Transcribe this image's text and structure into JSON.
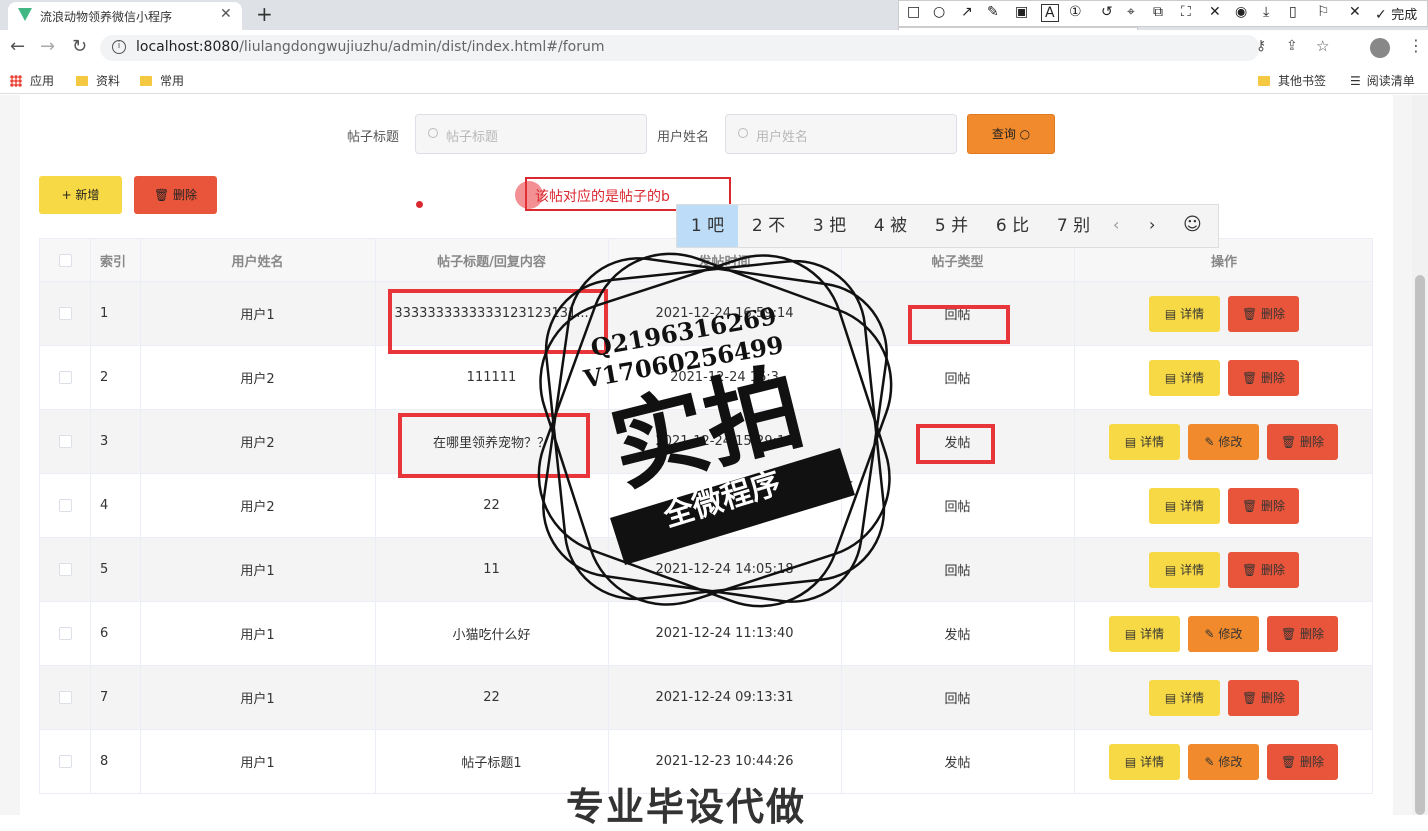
{
  "browser": {
    "tab_title": "流浪动物领养微信小程序",
    "tab_close": "✕",
    "new_tab": "+",
    "url_host": "localhost:8080",
    "url_rest": "/liulangdongwujiuzhu/admin/dist/index.html#/forum",
    "bookmarks": [
      "应用",
      "资料",
      "常用"
    ],
    "bookmarks_right": [
      "其他书签",
      "阅读清单"
    ]
  },
  "snip_tool": {
    "done_label": "完成",
    "font_size": "12",
    "current_color": "#e8353a",
    "palette": [
      "#000000",
      "#7f7f7f",
      "#880015",
      "#ed1c24",
      "#ff7f27",
      "#22b14c",
      "#3f48cc",
      "#a349a4",
      "#00a2e8",
      "#ffffff",
      "#c3c3c3",
      "#ff0000",
      "#ff3300",
      "#fff200",
      "#b5e61d",
      "#3399ff",
      "#cc33ff",
      "#33cccc"
    ]
  },
  "search": {
    "title_label": "帖子标题",
    "title_placeholder": "帖子标题",
    "user_label": "用户姓名",
    "user_placeholder": "用户姓名",
    "query_button": "查询"
  },
  "actions": {
    "add_button": "+ 新增",
    "delete_button": "删除"
  },
  "ime": {
    "input_text": "该帖对应的是帖子的b",
    "candidates": [
      "1 吧",
      "2 不",
      "3 把",
      "4 被",
      "5 并",
      "6 比",
      "7 别"
    ]
  },
  "table": {
    "headers": [
      "索引",
      "用户姓名",
      "帖子标题/回复内容",
      "发帖时间",
      "帖子类型",
      "操作"
    ],
    "rows": [
      {
        "index": "1",
        "user": "用户1",
        "content": "3333333333333123123131...",
        "time": "2021-12-24 16:59:14",
        "type": "回帖",
        "edit": false
      },
      {
        "index": "2",
        "user": "用户2",
        "content": "111111",
        "time": "2021-12-24 16:3",
        "type": "回帖",
        "edit": false
      },
      {
        "index": "3",
        "user": "用户2",
        "content": "在哪里领养宠物？？",
        "time": "2021-12-24 15:29:11",
        "type": "发帖",
        "edit": true
      },
      {
        "index": "4",
        "user": "用户2",
        "content": "22",
        "time": "2021-12-24 14:",
        "type": "回帖",
        "edit": false
      },
      {
        "index": "5",
        "user": "用户1",
        "content": "11",
        "time": "2021-12-24 14:05:18",
        "type": "回帖",
        "edit": false
      },
      {
        "index": "6",
        "user": "用户1",
        "content": "小猫吃什么好",
        "time": "2021-12-24 11:13:40",
        "type": "发帖",
        "edit": true
      },
      {
        "index": "7",
        "user": "用户1",
        "content": "22",
        "time": "2021-12-24 09:13:31",
        "type": "回帖",
        "edit": false
      },
      {
        "index": "8",
        "user": "用户1",
        "content": "帖子标题1",
        "time": "2021-12-23 10:44:26",
        "type": "发帖",
        "edit": true
      }
    ],
    "row_actions": {
      "detail": "详情",
      "edit": "修改",
      "delete": "删除"
    }
  },
  "watermark": {
    "qq": "Q2196316269",
    "vx": "V17060256499",
    "big": "实拍",
    "ribbon": "全微程序",
    "bottom": "专业毕设代做"
  }
}
